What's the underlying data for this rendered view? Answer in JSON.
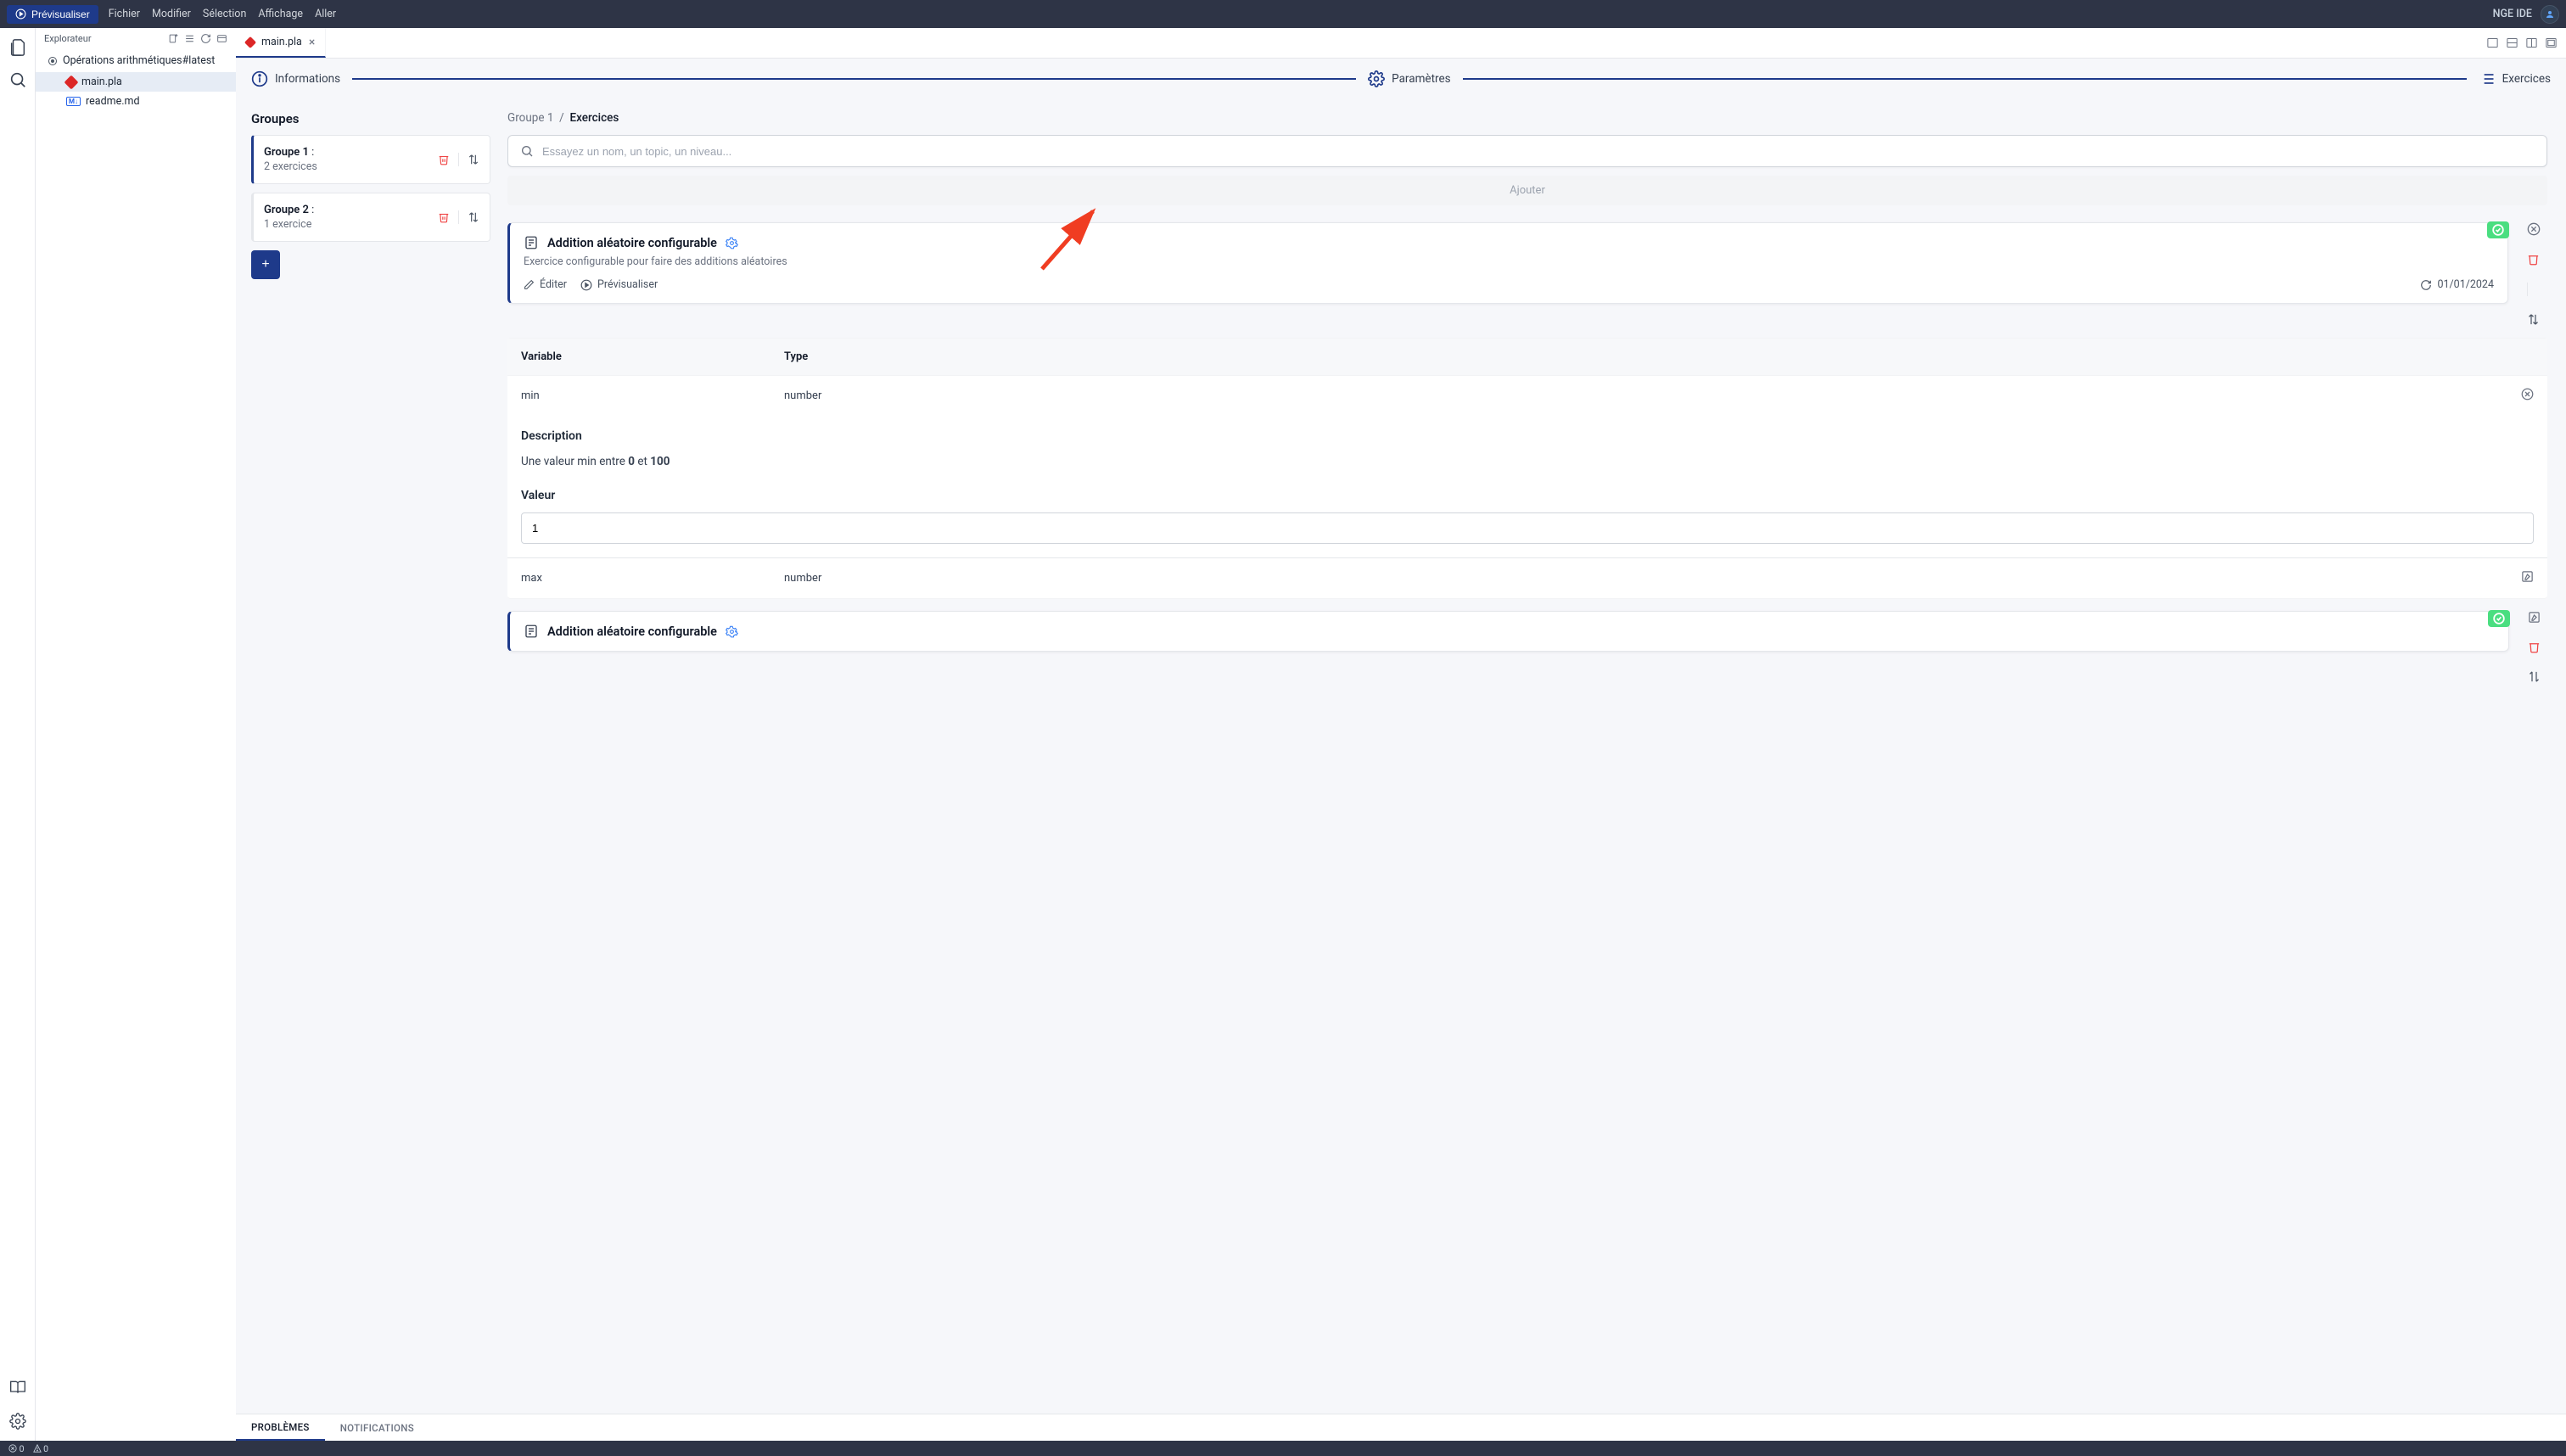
{
  "topbar": {
    "run": "Prévisualiser",
    "menus": [
      "Fichier",
      "Modifier",
      "Sélection",
      "Affichage",
      "Aller"
    ],
    "brand": "NGE IDE"
  },
  "explorer": {
    "title": "Explorateur",
    "project": "Opérations arithmétiques#latest",
    "files": [
      {
        "name": "main.pla",
        "icon": "diamond",
        "active": true
      },
      {
        "name": "readme.md",
        "icon": "md",
        "active": false
      }
    ]
  },
  "tab": {
    "label": "main.pla"
  },
  "nav": {
    "info": "Informations",
    "params": "Paramètres",
    "exercises": "Exercices"
  },
  "groups": {
    "title": "Groupes",
    "items": [
      {
        "name": "Groupe 1",
        "sub": "2 exercices",
        "active": true
      },
      {
        "name": "Groupe 2",
        "sub": "1 exercice",
        "active": false
      }
    ]
  },
  "breadcrumb": {
    "a": "Groupe 1",
    "b": "Exercices"
  },
  "search": {
    "placeholder": "Essayez un nom, un topic, un niveau..."
  },
  "add_label": "Ajouter",
  "exercise": {
    "title": "Addition aléatoire configurable",
    "desc": "Exercice configurable pour faire des additions aléatoires",
    "edit": "Éditer",
    "preview": "Prévisualiser",
    "date": "01/01/2024"
  },
  "vartable": {
    "col_var": "Variable",
    "col_type": "Type",
    "rows": [
      {
        "name": "min",
        "type": "number",
        "action": "remove"
      }
    ],
    "desc_title": "Description",
    "desc_prefix": "Une valeur min entre ",
    "desc_a": "0",
    "desc_mid": " et ",
    "desc_b": "100",
    "value_title": "Valeur",
    "value": "1",
    "row2": {
      "name": "max",
      "type": "number",
      "action": "edit"
    }
  },
  "exercise2": {
    "title": "Addition aléatoire configurable"
  },
  "bottom_tabs": {
    "problems": "Problèmes",
    "notifications": "Notifications"
  },
  "status": {
    "errors": "0",
    "warnings": "0"
  }
}
